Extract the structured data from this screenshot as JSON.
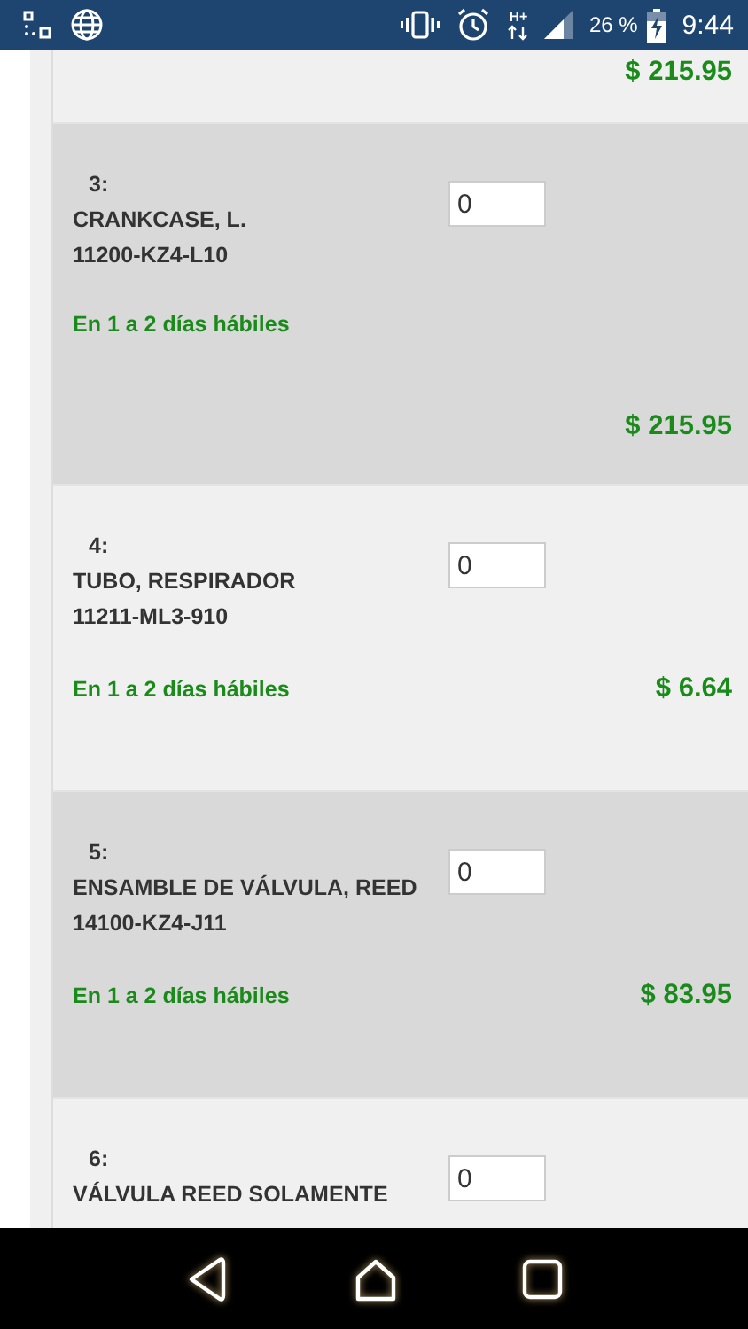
{
  "status_bar": {
    "network": "H+",
    "battery": "26 %",
    "time": "9:44"
  },
  "items": [
    {
      "kind": "tail",
      "price": "$ 215.95"
    },
    {
      "kind": "price-below",
      "number": "3:",
      "name": "CRANKCASE, L.",
      "code": "11200-KZ4-L10",
      "quantity": "0",
      "availability": "En 1 a 2 días hábiles",
      "price": "$ 215.95"
    },
    {
      "kind": "price-inline",
      "number": "4:",
      "name": "TUBO, RESPIRADOR",
      "code": "11211-ML3-910",
      "quantity": "0",
      "availability": "En 1 a 2 días hábiles",
      "price": "$ 6.64"
    },
    {
      "kind": "price-inline",
      "number": "5:",
      "name": "ENSAMBLE DE VÁLVULA, REED",
      "code": "14100-KZ4-J11",
      "quantity": "0",
      "availability": "En 1 a 2 días hábiles",
      "price": "$ 83.95"
    },
    {
      "kind": "head",
      "number": "6:",
      "name": "VÁLVULA REED SOLAMENTE",
      "quantity": "0"
    }
  ]
}
